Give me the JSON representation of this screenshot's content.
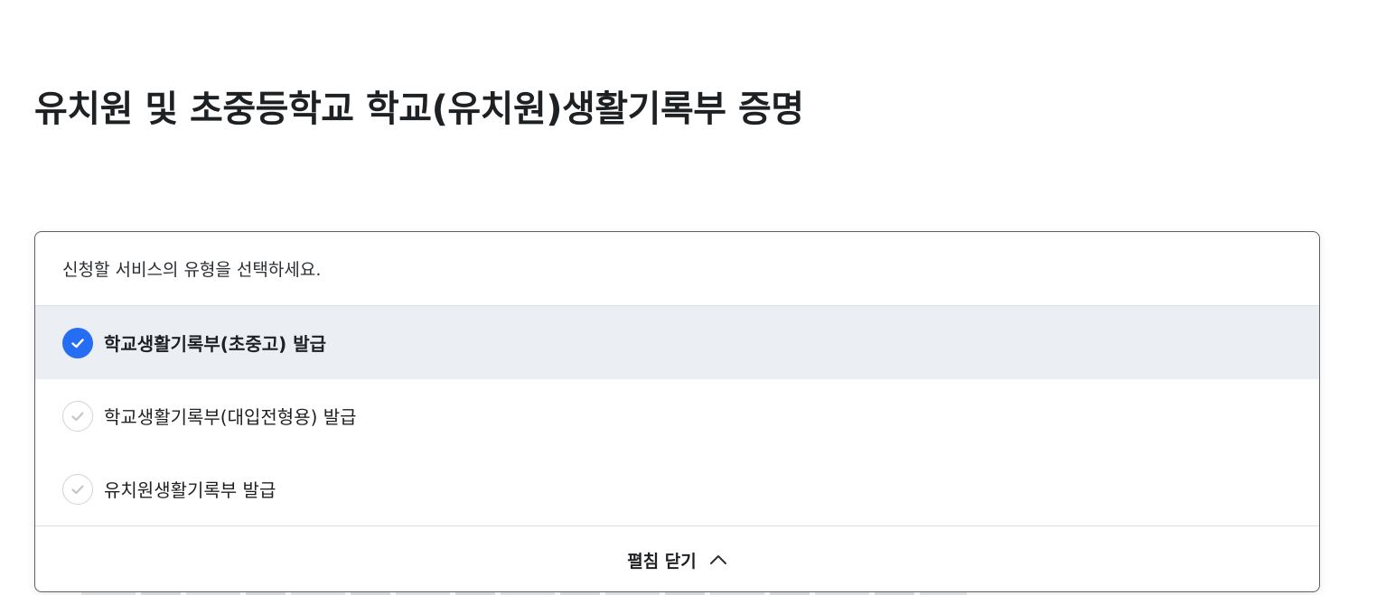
{
  "page": {
    "title": "유치원 및 초중등학교 학교(유치원)생활기록부 증명"
  },
  "service_select": {
    "prompt": "신청할 서비스의 유형을 선택하세요.",
    "options": [
      {
        "label": "학교생활기록부(초중고) 발급",
        "selected": true
      },
      {
        "label": "학교생활기록부(대입전형용) 발급",
        "selected": false
      },
      {
        "label": "유치원생활기록부 발급",
        "selected": false
      }
    ],
    "collapse_label": "펼침 닫기",
    "collapse_icon": "chevron-up-icon"
  },
  "colors": {
    "accent": "#256ef4",
    "selected_row_bg": "#ebeef3",
    "border": "#5c5f66"
  }
}
